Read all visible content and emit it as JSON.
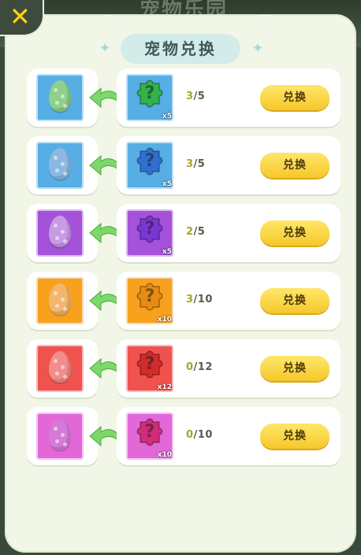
{
  "background": {
    "title": "宠物乐园"
  },
  "panel": {
    "title": "宠物兑换"
  },
  "close_icon": "close-x-icon",
  "button_label": "兑换",
  "rows": [
    {
      "egg_color": "#8fd08a",
      "box_color": "#56aee5",
      "puzzle_color": "#2fb34a",
      "multiplier": "x5",
      "have": "3",
      "need": "/5"
    },
    {
      "egg_color": "#8cb9e3",
      "box_color": "#56aee5",
      "puzzle_color": "#2f6fd0",
      "multiplier": "x5",
      "have": "3",
      "need": "/5"
    },
    {
      "egg_color": "#c89be6",
      "box_color": "#a452d9",
      "puzzle_color": "#7a36d4",
      "multiplier": "x5",
      "have": "2",
      "need": "/5"
    },
    {
      "egg_color": "#f5b56f",
      "box_color": "#f7a11f",
      "puzzle_color": "#e88b12",
      "multiplier": "x10",
      "have": "3",
      "need": "/10"
    },
    {
      "egg_color": "#f38c8c",
      "box_color": "#f0524e",
      "puzzle_color": "#d42a2a",
      "multiplier": "x12",
      "have": "0",
      "need": "/12"
    },
    {
      "egg_color": "#d57ad8",
      "box_color": "#e268d8",
      "puzzle_color": "#d42a7a",
      "multiplier": "x10",
      "have": "0",
      "need": "/10"
    }
  ]
}
